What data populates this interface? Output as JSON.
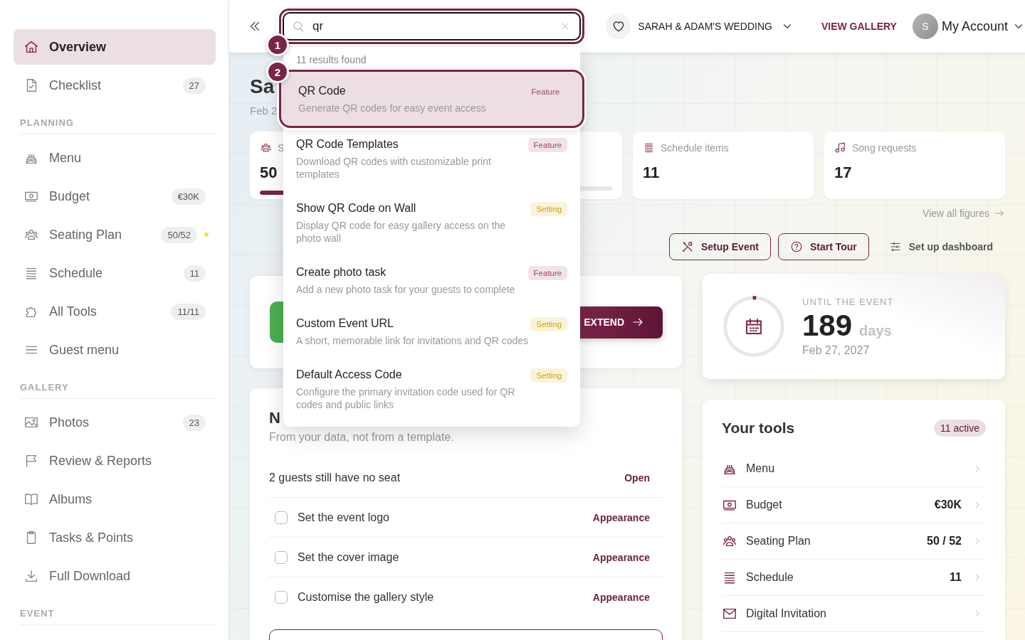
{
  "sidebar": {
    "groups": [
      {
        "items": [
          {
            "label": "Overview",
            "selected": true
          },
          {
            "label": "Checklist",
            "selected": false,
            "badge": "27"
          }
        ]
      },
      {
        "heading": "PLANNING",
        "items": [
          {
            "label": "Menu",
            "selected": false
          },
          {
            "label": "Budget",
            "selected": false,
            "badge": "€30K"
          },
          {
            "label": "Seating Plan",
            "selected": false,
            "badge": "50/52",
            "color": "#f6e33a"
          },
          {
            "label": "Schedule",
            "selected": false,
            "badge": "11"
          },
          {
            "label": "All Tools",
            "selected": false,
            "badge": "11/11"
          },
          {
            "label": "Guest menu",
            "selected": false
          }
        ]
      },
      {
        "heading": "GALLERY",
        "items": [
          {
            "label": "Photos",
            "selected": false,
            "badge": "23"
          },
          {
            "label": "Review & Reports",
            "selected": false
          },
          {
            "label": "Albums",
            "selected": false
          },
          {
            "label": "Tasks & Points",
            "selected": false
          },
          {
            "label": "Full Download",
            "selected": false
          }
        ]
      },
      {
        "heading": "EVENT"
      }
    ]
  },
  "header": {
    "search": {
      "value": "qr"
    },
    "event": "SARAH & ADAM'S WEDDING",
    "view_gallery": "VIEW GALLERY",
    "account": {
      "avatar": "S",
      "label": "My Account"
    }
  },
  "tour_markers": [
    "1",
    "2"
  ],
  "search_results": {
    "summary": "11 results found",
    "items": [
      {
        "title": "QR Code",
        "description": "Generate QR codes for easy event access",
        "tag": "Feature",
        "kind": "feature",
        "selected": true
      },
      {
        "title": "QR Code Templates",
        "description": "Download QR codes with customizable print templates",
        "tag": "Feature",
        "kind": "feature",
        "selected": false
      },
      {
        "title": "Show QR Code on Wall",
        "description": "Display QR code for easy gallery access on the photo wall",
        "tag": "Setting",
        "kind": "setting",
        "selected": false
      },
      {
        "title": "Create photo task",
        "description": "Add a new photo task for your guests to complete",
        "tag": "Feature",
        "kind": "feature",
        "selected": false
      },
      {
        "title": "Custom Event URL",
        "description": "A short, memorable link for invitations and QR codes",
        "tag": "Setting",
        "kind": "setting",
        "selected": false
      },
      {
        "title": "Default Access Code",
        "description": "Configure the primary invitation code used for QR codes and public links",
        "tag": "Setting",
        "kind": "setting",
        "selected": false
      }
    ]
  },
  "page": {
    "title": "Sa",
    "subtitle": "Feb 2"
  },
  "stats": [
    {
      "label": "S",
      "value": "50",
      "level": 0.96
    },
    {
      "label": "Schedule items",
      "value": "11"
    },
    {
      "label": "Song requests",
      "value": "17"
    }
  ],
  "view_all": "View all figures",
  "actions": [
    {
      "label": "Setup Event",
      "kind": "outline"
    },
    {
      "label": "Start Tour",
      "kind": "outline"
    },
    {
      "label": "Set up dashboard",
      "kind": "plain"
    }
  ],
  "promo": {
    "button": "EXTEND"
  },
  "countdown": {
    "label": "UNTIL THE EVENT",
    "number": "189",
    "unit": "days",
    "date": "Feb 27, 2027"
  },
  "suggestions": {
    "heading": "N",
    "subtitle": "From your data, not from a template.",
    "rows": [
      {
        "kind": "info",
        "text": "2 guests still have no seat",
        "action": "Open"
      },
      {
        "kind": "task",
        "text": "Set the event logo",
        "action": "Appearance",
        "checked": false
      },
      {
        "kind": "task",
        "text": "Set the cover image",
        "action": "Appearance",
        "checked": false
      },
      {
        "kind": "task",
        "text": "Customise the gallery style",
        "action": "Appearance",
        "checked": false
      }
    ]
  },
  "tools": {
    "title": "Your tools",
    "badge": "11 active",
    "items": [
      {
        "label": "Menu"
      },
      {
        "label": "Budget",
        "value": "€30K"
      },
      {
        "label": "Seating Plan",
        "value": "50 / 52"
      },
      {
        "label": "Schedule",
        "value": "11"
      },
      {
        "label": "Digital Invitation"
      }
    ]
  }
}
